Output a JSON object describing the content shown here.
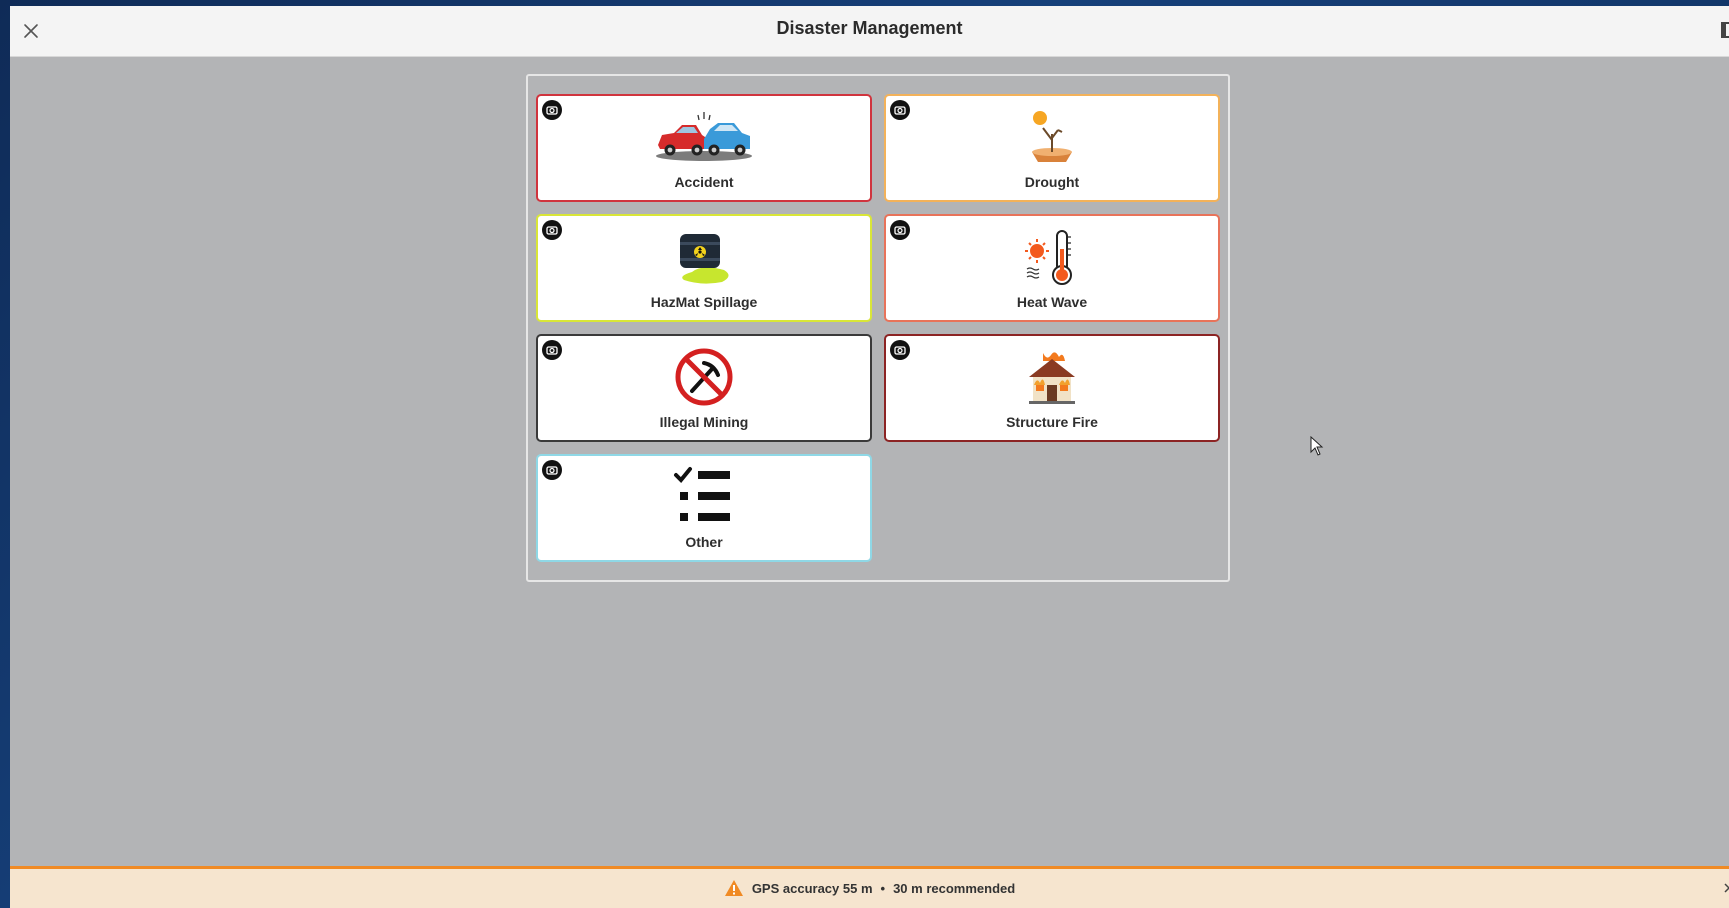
{
  "header": {
    "title": "Disaster Management",
    "close_icon": "close-icon"
  },
  "tiles": [
    {
      "label": "Accident",
      "icon": "car-crash-icon",
      "border": "#d0343e"
    },
    {
      "label": "Drought",
      "icon": "drought-icon",
      "border": "#f3b25a"
    },
    {
      "label": "HazMat Spillage",
      "icon": "hazmat-barrel-icon",
      "border": "#d9e637"
    },
    {
      "label": "Heat Wave",
      "icon": "thermometer-sun-icon",
      "border": "#e8735a"
    },
    {
      "label": "Illegal Mining",
      "icon": "no-mining-icon",
      "border": "#3a3a3a"
    },
    {
      "label": "Structure Fire",
      "icon": "house-fire-icon",
      "border": "#8c2424"
    },
    {
      "label": "Other",
      "icon": "checklist-icon",
      "border": "#8fd8e6"
    }
  ],
  "status": {
    "gps_accuracy": "GPS accuracy 55 m",
    "separator": "•",
    "recommended": "30 m recommended",
    "warning_icon": "warning-icon",
    "accent": "#f08a24"
  }
}
